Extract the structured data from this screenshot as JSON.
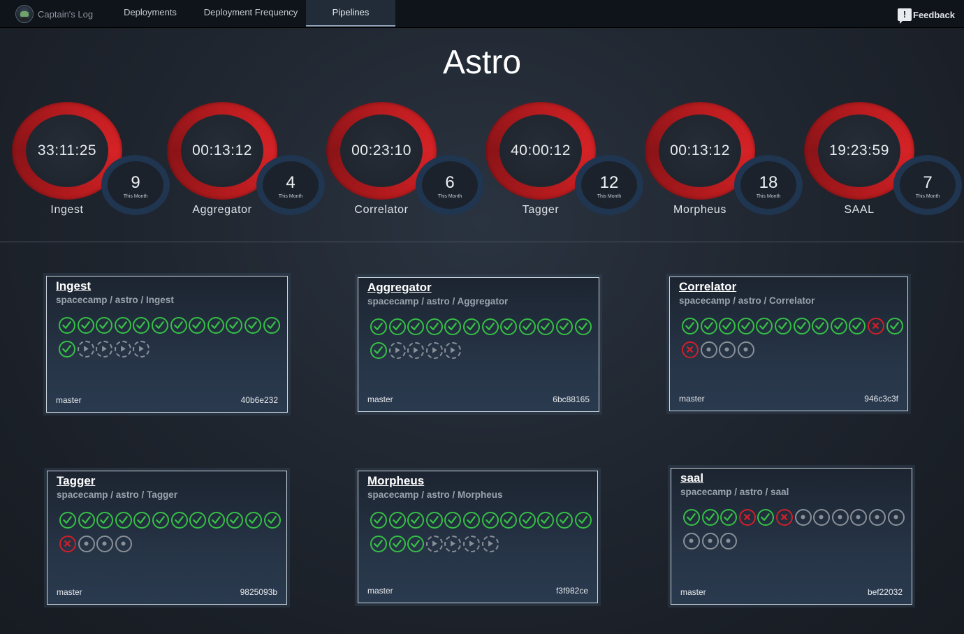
{
  "nav": {
    "brand": "Captain's Log",
    "items": [
      {
        "label": "Deployments",
        "active": false
      },
      {
        "label": "Deployment Frequency",
        "active": false
      },
      {
        "label": "Pipelines",
        "active": true
      }
    ],
    "feedback_icon": "!",
    "feedback_label": "Feedback"
  },
  "page_title": "Astro",
  "stats": [
    {
      "name": "Ingest",
      "duration": "33:11:25",
      "count": "9",
      "count_label": "This Month"
    },
    {
      "name": "Aggregator",
      "duration": "00:13:12",
      "count": "4",
      "count_label": "This Month"
    },
    {
      "name": "Correlator",
      "duration": "00:23:10",
      "count": "6",
      "count_label": "This Month"
    },
    {
      "name": "Tagger",
      "duration": "40:00:12",
      "count": "12",
      "count_label": "This Month"
    },
    {
      "name": "Morpheus",
      "duration": "00:13:12",
      "count": "18",
      "count_label": "This Month"
    },
    {
      "name": "SAAL",
      "duration": "19:23:59",
      "count": "7",
      "count_label": "This Month"
    }
  ],
  "pipelines": [
    {
      "title": "Ingest",
      "path": "spacecamp / astro / Ingest",
      "branch": "master",
      "commit": "40b6e232",
      "builds": [
        "ok",
        "ok",
        "ok",
        "ok",
        "ok",
        "ok",
        "ok",
        "ok",
        "ok",
        "ok",
        "ok",
        "ok",
        "ok",
        "run",
        "run",
        "run",
        "run"
      ]
    },
    {
      "title": "Aggregator",
      "path": "spacecamp / astro / Aggregator",
      "branch": "master",
      "commit": "6bc88165",
      "builds": [
        "ok",
        "ok",
        "ok",
        "ok",
        "ok",
        "ok",
        "ok",
        "ok",
        "ok",
        "ok",
        "ok",
        "ok",
        "ok",
        "run",
        "run",
        "run",
        "run"
      ]
    },
    {
      "title": "Correlator",
      "path": "spacecamp / astro / Correlator",
      "branch": "master",
      "commit": "946c3c3f",
      "builds": [
        "ok",
        "ok",
        "ok",
        "ok",
        "ok",
        "ok",
        "ok",
        "ok",
        "ok",
        "ok",
        "fail",
        "ok",
        "fail",
        "pend",
        "pend",
        "pend"
      ]
    },
    {
      "title": "Tagger",
      "path": "spacecamp / astro / Tagger",
      "branch": "master",
      "commit": "9825093b",
      "builds": [
        "ok",
        "ok",
        "ok",
        "ok",
        "ok",
        "ok",
        "ok",
        "ok",
        "ok",
        "ok",
        "ok",
        "ok",
        "fail",
        "pend",
        "pend",
        "pend"
      ]
    },
    {
      "title": "Morpheus",
      "path": "spacecamp / astro / Morpheus",
      "branch": "master",
      "commit": "f3f982ce",
      "builds": [
        "ok",
        "ok",
        "ok",
        "ok",
        "ok",
        "ok",
        "ok",
        "ok",
        "ok",
        "ok",
        "ok",
        "ok",
        "ok",
        "ok",
        "ok",
        "run",
        "run",
        "run",
        "run"
      ]
    },
    {
      "title": "saal",
      "path": "spacecamp / astro / saal",
      "branch": "master",
      "commit": "bef22032",
      "builds": [
        "ok",
        "ok",
        "ok",
        "fail",
        "ok",
        "fail",
        "pend",
        "pend",
        "pend",
        "pend",
        "pend",
        "pend",
        "pend",
        "pend",
        "pend"
      ]
    }
  ],
  "icons": {
    "ok": "check-icon",
    "fail": "x-icon",
    "pend": "dot-icon",
    "run": "play-icon"
  },
  "colors": {
    "ok": "#36c046",
    "fail": "#d11f2a",
    "pending": "#8a9098",
    "ring_red": "#c21e22",
    "ring_blue": "#1f3550"
  }
}
